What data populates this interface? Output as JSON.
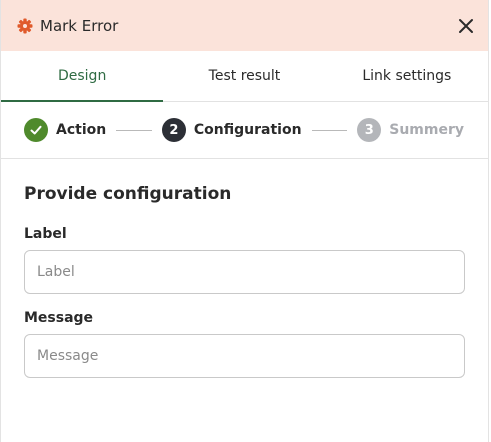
{
  "header": {
    "title": "Mark Error",
    "gear_icon": "gear-icon",
    "close_icon": "close-icon",
    "accent_color": "#e05a2b",
    "background_color": "#fbe3da"
  },
  "tabs": [
    {
      "label": "Design",
      "active": true
    },
    {
      "label": "Test result",
      "active": false
    },
    {
      "label": "Link settings",
      "active": false
    }
  ],
  "stepper": {
    "steps": [
      {
        "number": "1",
        "label": "Action",
        "state": "done"
      },
      {
        "number": "2",
        "label": "Configuration",
        "state": "current"
      },
      {
        "number": "3",
        "label": "Summery",
        "state": "pending"
      }
    ]
  },
  "form": {
    "title": "Provide configuration",
    "fields": [
      {
        "label": "Label",
        "placeholder": "Label",
        "value": ""
      },
      {
        "label": "Message",
        "placeholder": "Message",
        "value": ""
      }
    ]
  },
  "colors": {
    "active_tab": "#2f6b43",
    "step_done": "#4f8a2c",
    "step_current": "#2c2f36",
    "step_pending": "#b4b6ba"
  }
}
